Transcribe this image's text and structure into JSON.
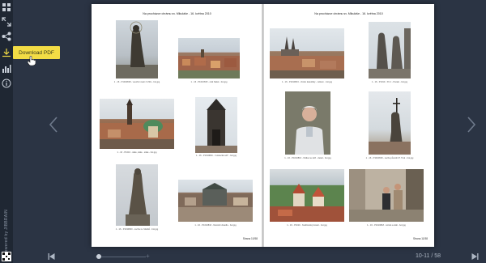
{
  "toolbar": {
    "download_tooltip": "Download PDF",
    "powered_by": "Powered by JIBBRAIN",
    "icons": [
      "grid-icon",
      "fullscreen-icon",
      "share-icon",
      "download-icon",
      "stats-icon",
      "info-icon"
    ]
  },
  "book": {
    "left_page": {
      "title": "Na procházce chrámu sv. Mikuláše - 16. května 2010",
      "page_label": "Strana 10/58",
      "captions": [
        "1 - 16 - P1010818 - vsechni svatí z kříže - bot.jpg",
        "1 - 16 - P1010815 - celk Sálek - bot.jpg",
        "1 - 16 - P1010 - stále, stále - stále - bot.jpg",
        "1 - 16 - P1010816 - 'mostecká věž' - bot.jpg",
        "1 - 16 - P1010820 - socha sv. Mariků - bot.jpg",
        "1 - 16 - P1010816 - Národní divadlo - bot.jpg"
      ]
    },
    "right_page": {
      "title": "Na procházce chrámu sv. Mikuláše - 16. května 2010",
      "page_label": "Strana 11/58",
      "captions": [
        "1 - 16 - P1010813 - chrám katedrály - celkem - bot.jpg",
        "1 - 16 - P1010 - SV 1 - Paralo - bot.jpg",
        "1 - 16 - P1010816 - hlidka na věži - detail - bot.jpg",
        "1 - 16 - P1010818 - socha původní P. Trek - bot.jpg",
        "1 - 16 - P1010 - hradčanský kostel - bot.jpg",
        "1 - 16 - P1010818 - turisté a stáli - bot.jpg"
      ]
    }
  },
  "navigation": {
    "page_counter": "10-11 / 58",
    "zoom_plus": "+"
  },
  "colors": {
    "background": "#2b3444",
    "sidebar": "#1f2733",
    "tooltip": "#f3dc45"
  }
}
